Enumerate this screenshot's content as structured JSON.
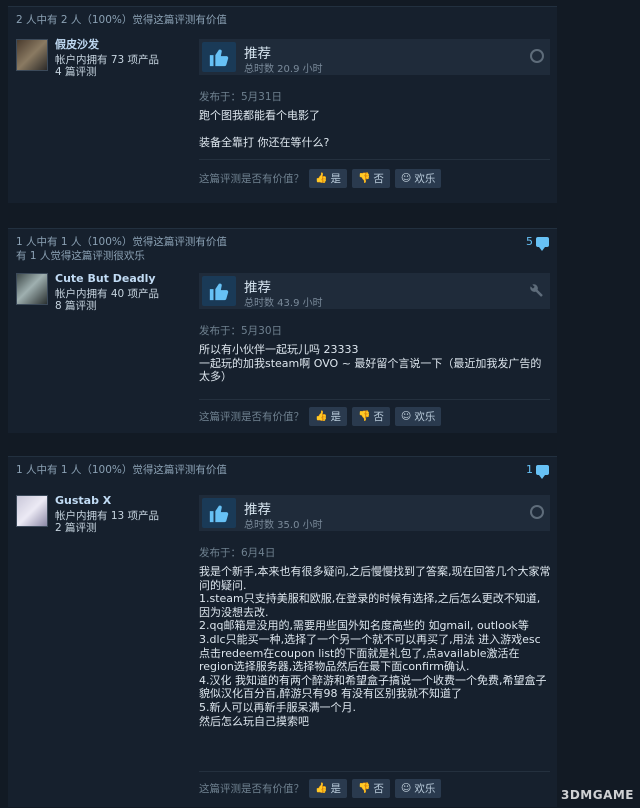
{
  "reviews": [
    {
      "helpful_stats": "2 人中有 2 人（100%）觉得这篇评测有价值",
      "funny_stats": "",
      "comment_count": "",
      "author_name": "假皮沙发",
      "products": "帐户内拥有 73 项产品",
      "review_count": "4 篇评测",
      "recommendation": "推荐",
      "hours": "总时数 20.9 小时",
      "posted": "发布于：5月31日",
      "content": [
        "跑个图我都能看个电影了",
        "",
        "装备全靠打 你还在等什么?"
      ],
      "helpful_prompt": "这篇评测是否有价值？",
      "yes_label": "是",
      "no_label": "否",
      "funny_label": "欢乐"
    },
    {
      "helpful_stats": "1 人中有 1 人（100%）觉得这篇评测有价值",
      "funny_stats": "有 1 人觉得这篇评测很欢乐",
      "comment_count": "5",
      "author_name": "Cute But Deadly",
      "products": "帐户内拥有 40 项产品",
      "review_count": "8 篇评测",
      "recommendation": "推荐",
      "hours": "总时数 43.9 小时",
      "posted": "发布于：5月30日",
      "content": [
        "所以有小伙伴一起玩儿吗 23333",
        "一起玩的加我steam啊 OVO ~ 最好留个言说一下（最近加我发广告的太多）"
      ],
      "helpful_prompt": "这篇评测是否有价值？",
      "yes_label": "是",
      "no_label": "否",
      "funny_label": "欢乐"
    },
    {
      "helpful_stats": "1 人中有 1 人（100%）觉得这篇评测有价值",
      "funny_stats": "",
      "comment_count": "1",
      "author_name": "Gustab X",
      "products": "帐户内拥有 13 项产品",
      "review_count": "2 篇评测",
      "recommendation": "推荐",
      "hours": "总时数 35.0 小时",
      "posted": "发布于：6月4日",
      "content": [
        "我是个新手,本来也有很多疑问,之后慢慢找到了答案,现在回答几个大家常问的疑问.",
        "1.steam只支持美服和欧服,在登录的时候有选择,之后怎么更改不知道,因为没想去改.",
        "2.qq邮箱是没用的,需要用些国外知名度高些的 如gmail, outlook等",
        "3.dlc只能买一种,选择了一个另一个就不可以再买了,用法 进入游戏esc点击redeem在coupon list的下面就是礼包了,点available激活在region选择服务器,选择物品然后在最下面confirm确认.",
        "4.汉化 我知道的有两个醉游和希望盒子搞说一个收费一个免费,希望盒子貌似汉化百分百,醉游只有98 有没有区别我就不知道了",
        "5.新人可以再新手服呆满一个月.",
        "然后怎么玩自己摸索吧"
      ],
      "helpful_prompt": "这篇评测是否有价值？",
      "yes_label": "是",
      "no_label": "否",
      "funny_label": "欢乐"
    }
  ],
  "watermark": "3DMGAME",
  "colors": {
    "accent": "#67c1f5",
    "thumb_bg": "#1a3a57",
    "card_bg": "#16202d"
  },
  "icons": [
    "thumbs-up-icon",
    "steam-icon",
    "wrench-icon",
    "comment-icon",
    "smile-icon",
    "thumbs-down-icon"
  ]
}
